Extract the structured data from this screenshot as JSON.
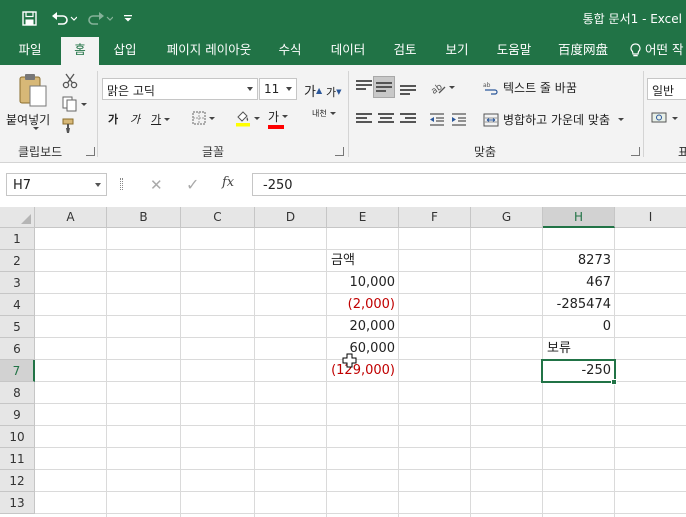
{
  "titlebar": {
    "title": "통합 문서1  -  Excel",
    "save_icon": "save-icon",
    "undo_icon": "undo-icon",
    "redo_icon": "redo-icon",
    "customize_icon": "customize-quick-access-icon"
  },
  "ribbon_tabs": [
    {
      "label": "파일"
    },
    {
      "label": "홈",
      "active": true
    },
    {
      "label": "삽입"
    },
    {
      "label": "페이지 레이아웃"
    },
    {
      "label": "수식"
    },
    {
      "label": "데이터"
    },
    {
      "label": "검토"
    },
    {
      "label": "보기"
    },
    {
      "label": "도움말"
    },
    {
      "label": "百度网盘"
    },
    {
      "label": "어떤 작"
    }
  ],
  "ribbon": {
    "clipboard": {
      "group_label": "클립보드",
      "paste_label": "붙여넣기"
    },
    "font": {
      "group_label": "글꼴",
      "font_name": "맑은 고딕",
      "font_size": "11",
      "increase_size_label": "가",
      "decrease_size_label": "가",
      "bold_label": "가",
      "italic_label": "가",
      "underline_label": "가",
      "font_color_label": "가",
      "phonetic_label": "내천"
    },
    "alignment": {
      "group_label": "맞춤",
      "wrap_text_label": "텍스트 줄 바꿈",
      "merge_center_label": "병합하고 가운데 맞춤"
    },
    "number": {
      "format_value": "일반",
      "group_label_partial": "표"
    }
  },
  "formula_bar": {
    "name_box": "H7",
    "cancel_symbol": "✕",
    "enter_symbol": "✓",
    "fx_label": "fx",
    "formula_value": "-250"
  },
  "sheet": {
    "columns": [
      "A",
      "B",
      "C",
      "D",
      "E",
      "F",
      "G",
      "H",
      "I"
    ],
    "rows": [
      "1",
      "2",
      "3",
      "4",
      "5",
      "6",
      "7",
      "8",
      "9",
      "10",
      "11",
      "12",
      "13"
    ],
    "selected_cell": "H7",
    "cells": {
      "E2": "금액",
      "E3": "10,000",
      "E4": "(2,000)",
      "E5": "20,000",
      "E6": "60,000",
      "E7": "(129,000)",
      "H2": "8273",
      "H3": "467",
      "H4": "-285474",
      "H5": "0",
      "H6": "보류",
      "H7": "-250"
    },
    "negative_color": "#c00000"
  },
  "colors": {
    "excel_green": "#217346",
    "ribbon_bg": "#f3f3f3"
  }
}
